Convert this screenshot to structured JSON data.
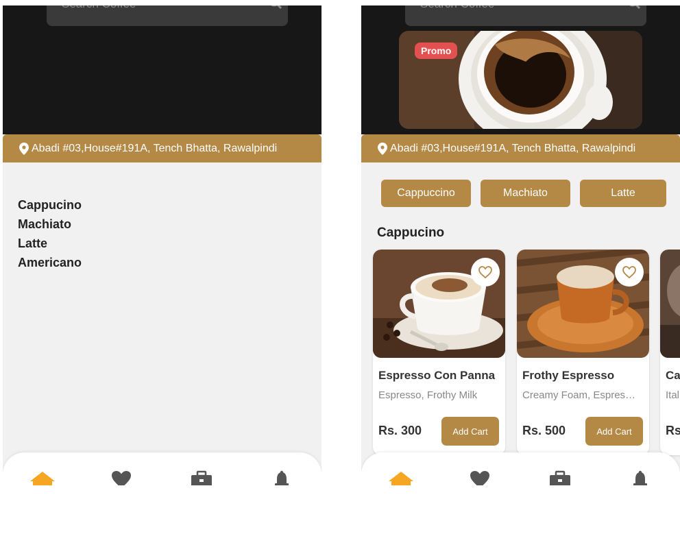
{
  "search": {
    "placeholder": "Search Coffee"
  },
  "location": {
    "address": "Abadi #03,House#191A, Tench Bhatta, Rawalpindi"
  },
  "left_menu": {
    "items": [
      "Cappucino",
      "Machiato",
      "Latte",
      "Americano"
    ]
  },
  "promo": {
    "badge": "Promo"
  },
  "categories": [
    "Cappuccino",
    "Machiato",
    "Latte"
  ],
  "section": {
    "title": "Cappucino"
  },
  "products": [
    {
      "name": "Espresso Con Panna",
      "desc": "Espresso, Frothy Milk",
      "price": "Rs. 300",
      "button": "Add Cart"
    },
    {
      "name": "Frothy Espresso",
      "desc": "Creamy Foam, Espres…",
      "price": "Rs. 500",
      "button": "Add Cart"
    },
    {
      "name": "Ca",
      "desc": "Ital",
      "price": "Rs",
      "button": ""
    }
  ],
  "nav": {
    "icons": [
      "home-icon",
      "heart-icon",
      "briefcase-icon",
      "bell-icon"
    ],
    "active_color": "#f5a623"
  },
  "colors": {
    "accent": "#b48845",
    "promo": "#e25050",
    "dark": "#171717"
  }
}
